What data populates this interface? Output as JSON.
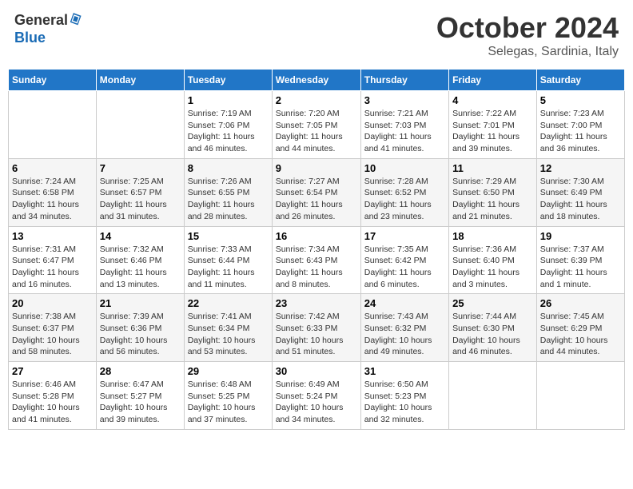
{
  "header": {
    "logo_general": "General",
    "logo_blue": "Blue",
    "month_title": "October 2024",
    "location": "Selegas, Sardinia, Italy"
  },
  "days_of_week": [
    "Sunday",
    "Monday",
    "Tuesday",
    "Wednesday",
    "Thursday",
    "Friday",
    "Saturday"
  ],
  "weeks": [
    [
      {
        "day": "",
        "info": ""
      },
      {
        "day": "",
        "info": ""
      },
      {
        "day": "1",
        "info": "Sunrise: 7:19 AM\nSunset: 7:06 PM\nDaylight: 11 hours and 46 minutes."
      },
      {
        "day": "2",
        "info": "Sunrise: 7:20 AM\nSunset: 7:05 PM\nDaylight: 11 hours and 44 minutes."
      },
      {
        "day": "3",
        "info": "Sunrise: 7:21 AM\nSunset: 7:03 PM\nDaylight: 11 hours and 41 minutes."
      },
      {
        "day": "4",
        "info": "Sunrise: 7:22 AM\nSunset: 7:01 PM\nDaylight: 11 hours and 39 minutes."
      },
      {
        "day": "5",
        "info": "Sunrise: 7:23 AM\nSunset: 7:00 PM\nDaylight: 11 hours and 36 minutes."
      }
    ],
    [
      {
        "day": "6",
        "info": "Sunrise: 7:24 AM\nSunset: 6:58 PM\nDaylight: 11 hours and 34 minutes."
      },
      {
        "day": "7",
        "info": "Sunrise: 7:25 AM\nSunset: 6:57 PM\nDaylight: 11 hours and 31 minutes."
      },
      {
        "day": "8",
        "info": "Sunrise: 7:26 AM\nSunset: 6:55 PM\nDaylight: 11 hours and 28 minutes."
      },
      {
        "day": "9",
        "info": "Sunrise: 7:27 AM\nSunset: 6:54 PM\nDaylight: 11 hours and 26 minutes."
      },
      {
        "day": "10",
        "info": "Sunrise: 7:28 AM\nSunset: 6:52 PM\nDaylight: 11 hours and 23 minutes."
      },
      {
        "day": "11",
        "info": "Sunrise: 7:29 AM\nSunset: 6:50 PM\nDaylight: 11 hours and 21 minutes."
      },
      {
        "day": "12",
        "info": "Sunrise: 7:30 AM\nSunset: 6:49 PM\nDaylight: 11 hours and 18 minutes."
      }
    ],
    [
      {
        "day": "13",
        "info": "Sunrise: 7:31 AM\nSunset: 6:47 PM\nDaylight: 11 hours and 16 minutes."
      },
      {
        "day": "14",
        "info": "Sunrise: 7:32 AM\nSunset: 6:46 PM\nDaylight: 11 hours and 13 minutes."
      },
      {
        "day": "15",
        "info": "Sunrise: 7:33 AM\nSunset: 6:44 PM\nDaylight: 11 hours and 11 minutes."
      },
      {
        "day": "16",
        "info": "Sunrise: 7:34 AM\nSunset: 6:43 PM\nDaylight: 11 hours and 8 minutes."
      },
      {
        "day": "17",
        "info": "Sunrise: 7:35 AM\nSunset: 6:42 PM\nDaylight: 11 hours and 6 minutes."
      },
      {
        "day": "18",
        "info": "Sunrise: 7:36 AM\nSunset: 6:40 PM\nDaylight: 11 hours and 3 minutes."
      },
      {
        "day": "19",
        "info": "Sunrise: 7:37 AM\nSunset: 6:39 PM\nDaylight: 11 hours and 1 minute."
      }
    ],
    [
      {
        "day": "20",
        "info": "Sunrise: 7:38 AM\nSunset: 6:37 PM\nDaylight: 10 hours and 58 minutes."
      },
      {
        "day": "21",
        "info": "Sunrise: 7:39 AM\nSunset: 6:36 PM\nDaylight: 10 hours and 56 minutes."
      },
      {
        "day": "22",
        "info": "Sunrise: 7:41 AM\nSunset: 6:34 PM\nDaylight: 10 hours and 53 minutes."
      },
      {
        "day": "23",
        "info": "Sunrise: 7:42 AM\nSunset: 6:33 PM\nDaylight: 10 hours and 51 minutes."
      },
      {
        "day": "24",
        "info": "Sunrise: 7:43 AM\nSunset: 6:32 PM\nDaylight: 10 hours and 49 minutes."
      },
      {
        "day": "25",
        "info": "Sunrise: 7:44 AM\nSunset: 6:30 PM\nDaylight: 10 hours and 46 minutes."
      },
      {
        "day": "26",
        "info": "Sunrise: 7:45 AM\nSunset: 6:29 PM\nDaylight: 10 hours and 44 minutes."
      }
    ],
    [
      {
        "day": "27",
        "info": "Sunrise: 6:46 AM\nSunset: 5:28 PM\nDaylight: 10 hours and 41 minutes."
      },
      {
        "day": "28",
        "info": "Sunrise: 6:47 AM\nSunset: 5:27 PM\nDaylight: 10 hours and 39 minutes."
      },
      {
        "day": "29",
        "info": "Sunrise: 6:48 AM\nSunset: 5:25 PM\nDaylight: 10 hours and 37 minutes."
      },
      {
        "day": "30",
        "info": "Sunrise: 6:49 AM\nSunset: 5:24 PM\nDaylight: 10 hours and 34 minutes."
      },
      {
        "day": "31",
        "info": "Sunrise: 6:50 AM\nSunset: 5:23 PM\nDaylight: 10 hours and 32 minutes."
      },
      {
        "day": "",
        "info": ""
      },
      {
        "day": "",
        "info": ""
      }
    ]
  ]
}
